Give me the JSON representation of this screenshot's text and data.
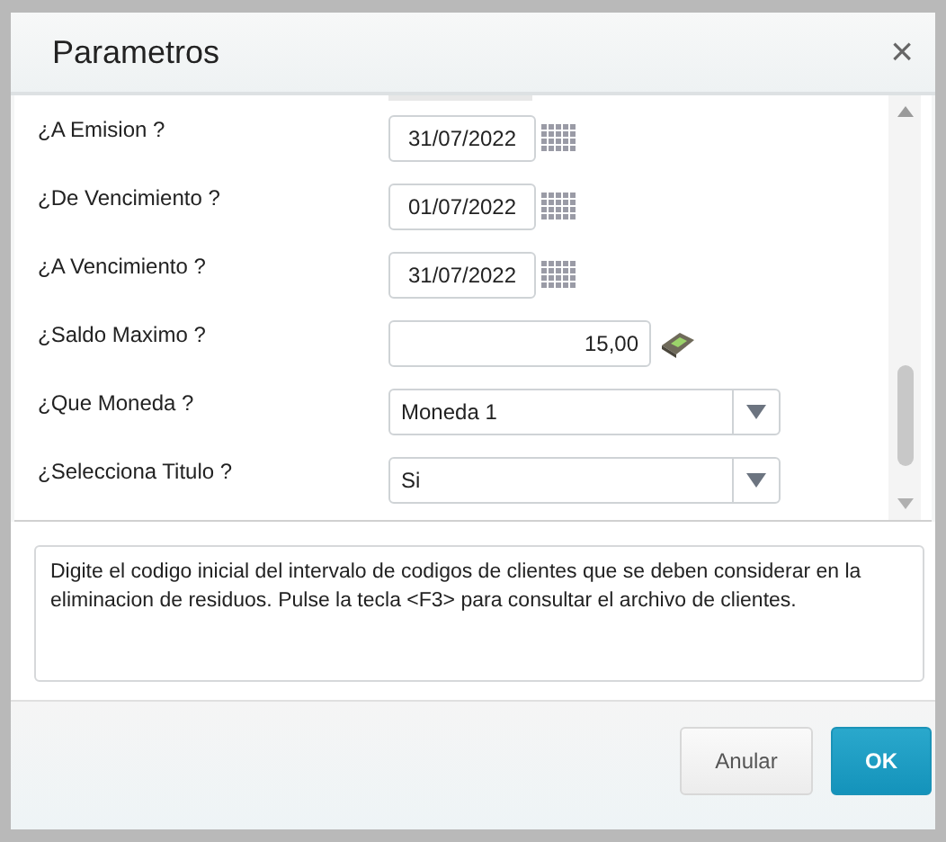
{
  "window": {
    "title": "Parametros",
    "close": "×"
  },
  "fields": [
    {
      "label": "¿A Emision ?",
      "kind": "date",
      "value": "31/07/2022"
    },
    {
      "label": "¿De Vencimiento ?",
      "kind": "date",
      "value": "01/07/2022"
    },
    {
      "label": "¿A Vencimiento ?",
      "kind": "date",
      "value": "31/07/2022"
    },
    {
      "label": "¿Saldo Maximo ?",
      "kind": "number",
      "value": "15,00"
    },
    {
      "label": "¿Que Moneda ?",
      "kind": "select",
      "value": "Moneda 1"
    },
    {
      "label": "¿Selecciona Titulo ?",
      "kind": "select",
      "value": "Si"
    }
  ],
  "help_text": "Digite el codigo inicial del intervalo de codigos de clientes que se deben considerar en la eliminacion de residuos. Pulse la tecla <F3> para consultar el archivo de clientes.",
  "buttons": [
    {
      "label": "Anular",
      "kind": "secondary"
    },
    {
      "label": "OK",
      "kind": "primary"
    }
  ]
}
